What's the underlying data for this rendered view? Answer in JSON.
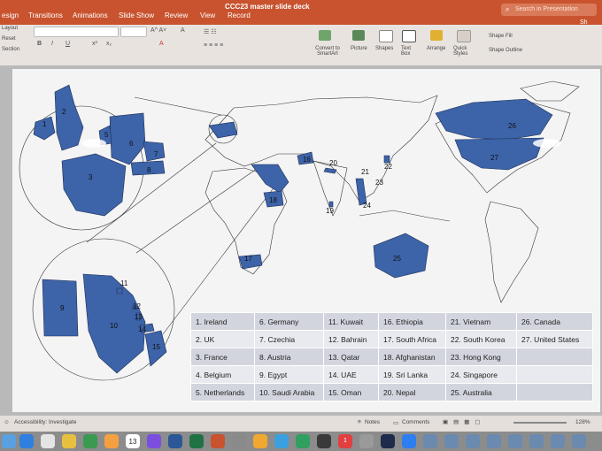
{
  "window": {
    "title": "CCC23 master slide deck",
    "search_placeholder": "Search in Presentation",
    "share": "Sh"
  },
  "tabs": [
    {
      "label": "esign"
    },
    {
      "label": "Transitions"
    },
    {
      "label": "Animations"
    },
    {
      "label": "Slide Show"
    },
    {
      "label": "Review"
    },
    {
      "label": "View"
    },
    {
      "label": "Record"
    }
  ],
  "toolbar": {
    "layout": "Layout",
    "reset": "Reset",
    "section": "Section",
    "convert_smartart": "Convert to SmartArt",
    "picture": "Picture",
    "shapes": "Shapes",
    "text_box": "Text Box",
    "arrange": "Arrange",
    "quick_styles": "Quick Styles",
    "shape_fill": "Shape Fill",
    "shape_outline": "Shape Outline"
  },
  "colors": {
    "accent": "#c8532e",
    "country_fill": "#3d63a8"
  },
  "map": {
    "labels": [
      "1",
      "2",
      "3",
      "5",
      "6",
      "7",
      "8",
      "9",
      "10",
      "11",
      "12",
      "13",
      "14",
      "15",
      "16",
      "17",
      "18",
      "19",
      "20",
      "21",
      "22",
      "23",
      "24",
      "25",
      "26",
      "27"
    ]
  },
  "legend": [
    [
      "1. Ireland",
      "6. Germany",
      "11. Kuwait",
      "16. Ethiopia",
      "21. Vietnam",
      "26. Canada"
    ],
    [
      "2. UK",
      "7. Czechia",
      "12. Bahrain",
      "17. South Africa",
      "22. South Korea",
      "27. United States"
    ],
    [
      "3. France",
      "8. Austria",
      "13. Qatar",
      "18. Afghanistan",
      "23. Hong Kong",
      ""
    ],
    [
      "4. Belgium",
      "9. Egypt",
      "14. UAE",
      "19. Sri Lanka",
      "24. Singapore",
      ""
    ],
    [
      "5. Netherlands",
      "10. Saudi Arabia",
      "15. Oman",
      "20. Nepal",
      "25. Australia",
      ""
    ]
  ],
  "status": {
    "accessibility": "Accessibility: Investigate",
    "notes": "Notes",
    "comments": "Comments",
    "zoom": "128%"
  },
  "dock": {
    "calendar_day": "13",
    "badge": "1"
  }
}
